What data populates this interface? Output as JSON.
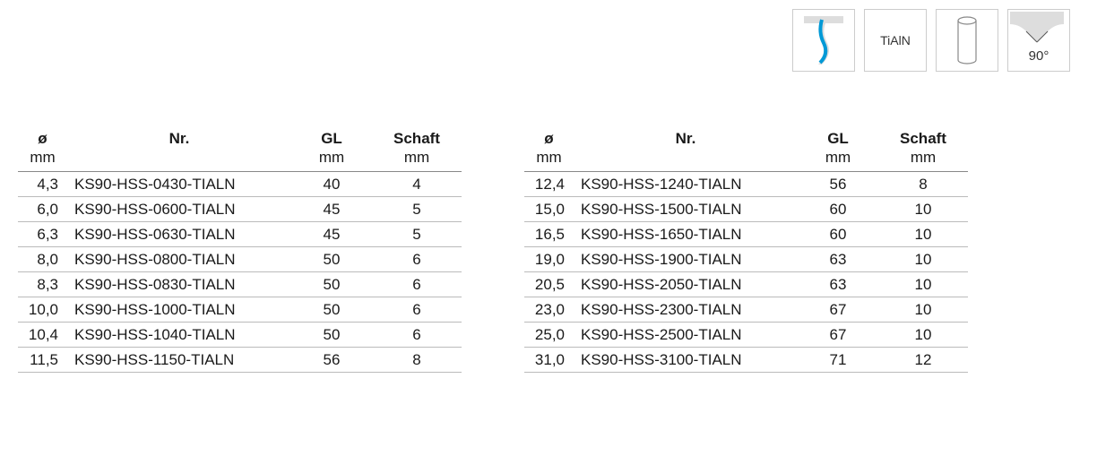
{
  "icons": {
    "coolant": "coolant-icon",
    "coating_label": "TiAlN",
    "shank": "shank-icon",
    "angle_label": "90°"
  },
  "headers": {
    "dia_top": "ø",
    "dia_sub": "mm",
    "nr_top": "Nr.",
    "nr_sub": "",
    "gl_top": "GL",
    "gl_sub": "mm",
    "schaft_top": "Schaft",
    "schaft_sub": "mm"
  },
  "table_left": [
    {
      "dia": "4,3",
      "nr": "KS90-HSS-0430-TIALN",
      "gl": "40",
      "schaft": "4"
    },
    {
      "dia": "6,0",
      "nr": "KS90-HSS-0600-TIALN",
      "gl": "45",
      "schaft": "5"
    },
    {
      "dia": "6,3",
      "nr": "KS90-HSS-0630-TIALN",
      "gl": "45",
      "schaft": "5"
    },
    {
      "dia": "8,0",
      "nr": "KS90-HSS-0800-TIALN",
      "gl": "50",
      "schaft": "6"
    },
    {
      "dia": "8,3",
      "nr": "KS90-HSS-0830-TIALN",
      "gl": "50",
      "schaft": "6"
    },
    {
      "dia": "10,0",
      "nr": "KS90-HSS-1000-TIALN",
      "gl": "50",
      "schaft": "6"
    },
    {
      "dia": "10,4",
      "nr": "KS90-HSS-1040-TIALN",
      "gl": "50",
      "schaft": "6"
    },
    {
      "dia": "11,5",
      "nr": "KS90-HSS-1150-TIALN",
      "gl": "56",
      "schaft": "8"
    }
  ],
  "table_right": [
    {
      "dia": "12,4",
      "nr": "KS90-HSS-1240-TIALN",
      "gl": "56",
      "schaft": "8"
    },
    {
      "dia": "15,0",
      "nr": "KS90-HSS-1500-TIALN",
      "gl": "60",
      "schaft": "10"
    },
    {
      "dia": "16,5",
      "nr": "KS90-HSS-1650-TIALN",
      "gl": "60",
      "schaft": "10"
    },
    {
      "dia": "19,0",
      "nr": "KS90-HSS-1900-TIALN",
      "gl": "63",
      "schaft": "10"
    },
    {
      "dia": "20,5",
      "nr": "KS90-HSS-2050-TIALN",
      "gl": "63",
      "schaft": "10"
    },
    {
      "dia": "23,0",
      "nr": "KS90-HSS-2300-TIALN",
      "gl": "67",
      "schaft": "10"
    },
    {
      "dia": "25,0",
      "nr": "KS90-HSS-2500-TIALN",
      "gl": "67",
      "schaft": "10"
    },
    {
      "dia": "31,0",
      "nr": "KS90-HSS-3100-TIALN",
      "gl": "71",
      "schaft": "12"
    }
  ]
}
